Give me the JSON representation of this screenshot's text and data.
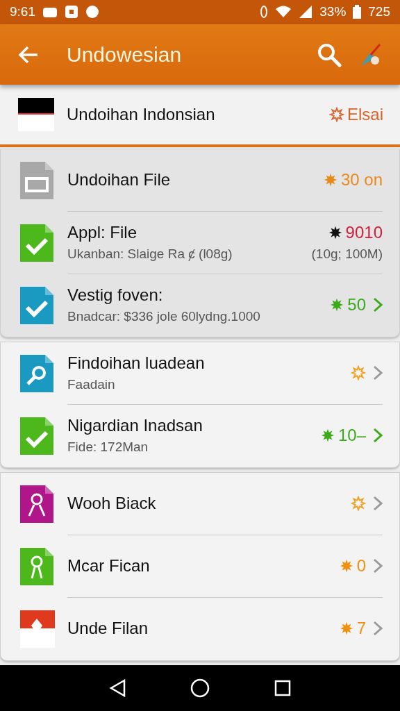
{
  "status_bar": {
    "time": "9:61",
    "battery": "33%",
    "extra": "725"
  },
  "app_bar": {
    "title": "Undowesian"
  },
  "header_row": {
    "title": "Undoihan Indonsian",
    "badge": {
      "text": "Elsai",
      "color": "#d9632a",
      "kind": "outline"
    }
  },
  "groups": [
    {
      "kind": "shaded",
      "rows": [
        {
          "kind": "file",
          "title": "Undoihan File",
          "badge": {
            "text": "30 on",
            "color": "#e8891a",
            "kind": "burst"
          },
          "chevron": false
        },
        {
          "kind": "check-green",
          "title": "Appl: File",
          "subtitle": "Ukanban: Slaige Ra ȼ (l08g)",
          "badge": {
            "text": "9010",
            "color": "#d0203a",
            "kind": "dark"
          },
          "detail": "(10g; 100M)",
          "chevron": false
        },
        {
          "kind": "check-blue",
          "title": "Vestig foven:",
          "subtitle": "Bnadcar: $336 jole 60lydng.1000",
          "badge": {
            "text": "50",
            "color": "#3aaa1a",
            "kind": "filled"
          },
          "chevron": true
        }
      ]
    },
    {
      "kind": "plain",
      "rows": [
        {
          "kind": "search",
          "title": "Findoihan luadean",
          "subtitle": "Faadain",
          "badge": {
            "color": "#f0a020",
            "kind": "outline"
          },
          "chevron": true
        },
        {
          "kind": "check-green",
          "title": "Nigardian Inadsan",
          "subtitle": "Fide: 172Man",
          "badge": {
            "text": "10–",
            "color": "#3aaa1a",
            "kind": "filled"
          },
          "chevron": true
        }
      ]
    },
    {
      "kind": "plain",
      "rows": [
        {
          "kind": "person-magenta",
          "title": "Wooh Biack",
          "badge": {
            "color": "#f0a020",
            "kind": "outline"
          },
          "chevron": true
        },
        {
          "kind": "person-green",
          "title": "Mcar Fican",
          "badge": {
            "text": "0",
            "color": "#f09010",
            "kind": "filled"
          },
          "chevron": true
        },
        {
          "kind": "flag-red",
          "title": "Unde Filan",
          "badge": {
            "text": "7",
            "color": "#f09010",
            "kind": "filled"
          },
          "chevron": true
        }
      ]
    }
  ]
}
